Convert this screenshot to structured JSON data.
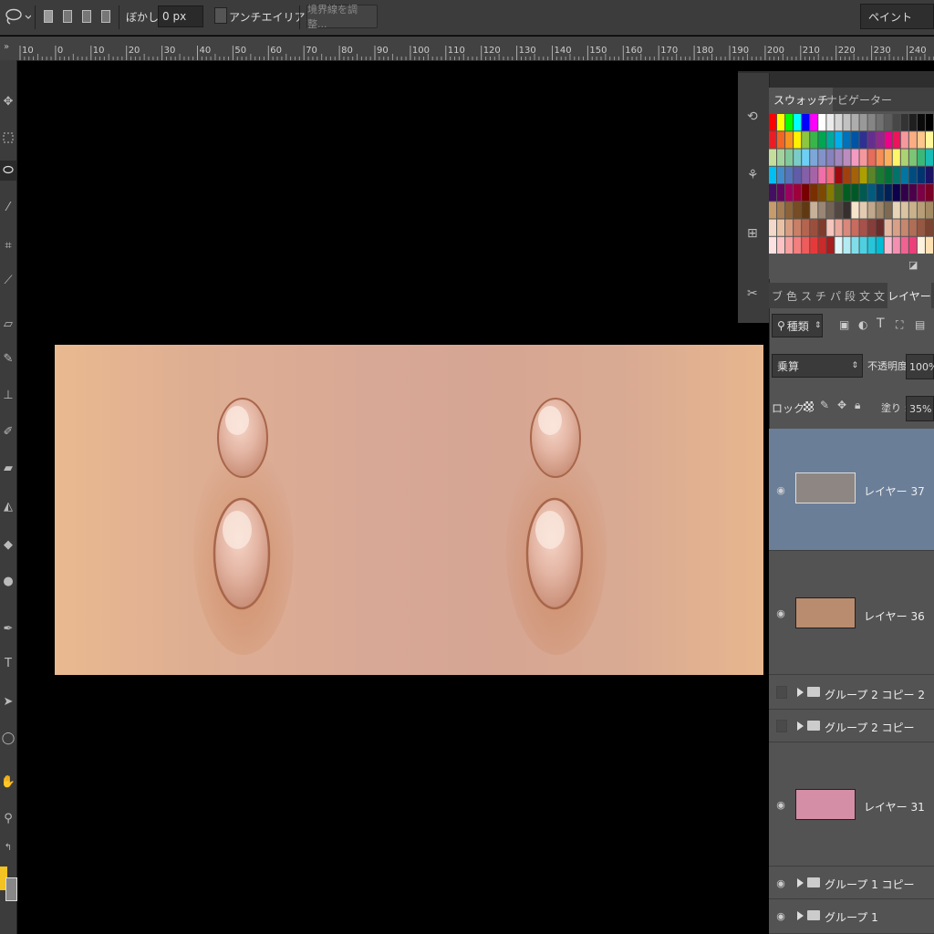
{
  "options_bar": {
    "feather_label": "ぼかし :",
    "feather_value": "0 px",
    "anti_alias_label": "アンチエイリアス",
    "refine_edge_label": "境界線を調整...",
    "workspace": "ペイント"
  },
  "ruler": {
    "ticks": [
      "10",
      "0",
      "10",
      "20",
      "30",
      "40",
      "50",
      "60",
      "70",
      "80",
      "90",
      "100",
      "110",
      "120",
      "130",
      "140",
      "150",
      "160",
      "170",
      "180",
      "190",
      "200",
      "210",
      "220",
      "230",
      "240"
    ]
  },
  "swatches_panel": {
    "tab_swatches": "スウォッチ",
    "tab_navigator": "ナビゲーター"
  },
  "layers_panel": {
    "tabs": [
      "ブ",
      "色",
      "ス",
      "チ",
      "パ",
      "段",
      "文",
      "文"
    ],
    "active_tab": "レイヤー",
    "filter_kind": "種類",
    "blend_mode": "乗算",
    "opacity_label": "不透明度 :",
    "opacity_value": "100%",
    "lock_label": "ロック :",
    "fill_label": "塗り :",
    "fill_value": "35%",
    "layers": [
      {
        "name": "レイヤー 37",
        "color": "#8e8682"
      },
      {
        "name": "レイヤー 36",
        "color": "#b98c6f"
      },
      {
        "name": "グループ 2 コピー 2"
      },
      {
        "name": "グループ 2 コピー"
      },
      {
        "name": "レイヤー 31",
        "color": "#d48ea5"
      },
      {
        "name": "グループ 1 コピー"
      },
      {
        "name": "グループ 1"
      }
    ]
  }
}
